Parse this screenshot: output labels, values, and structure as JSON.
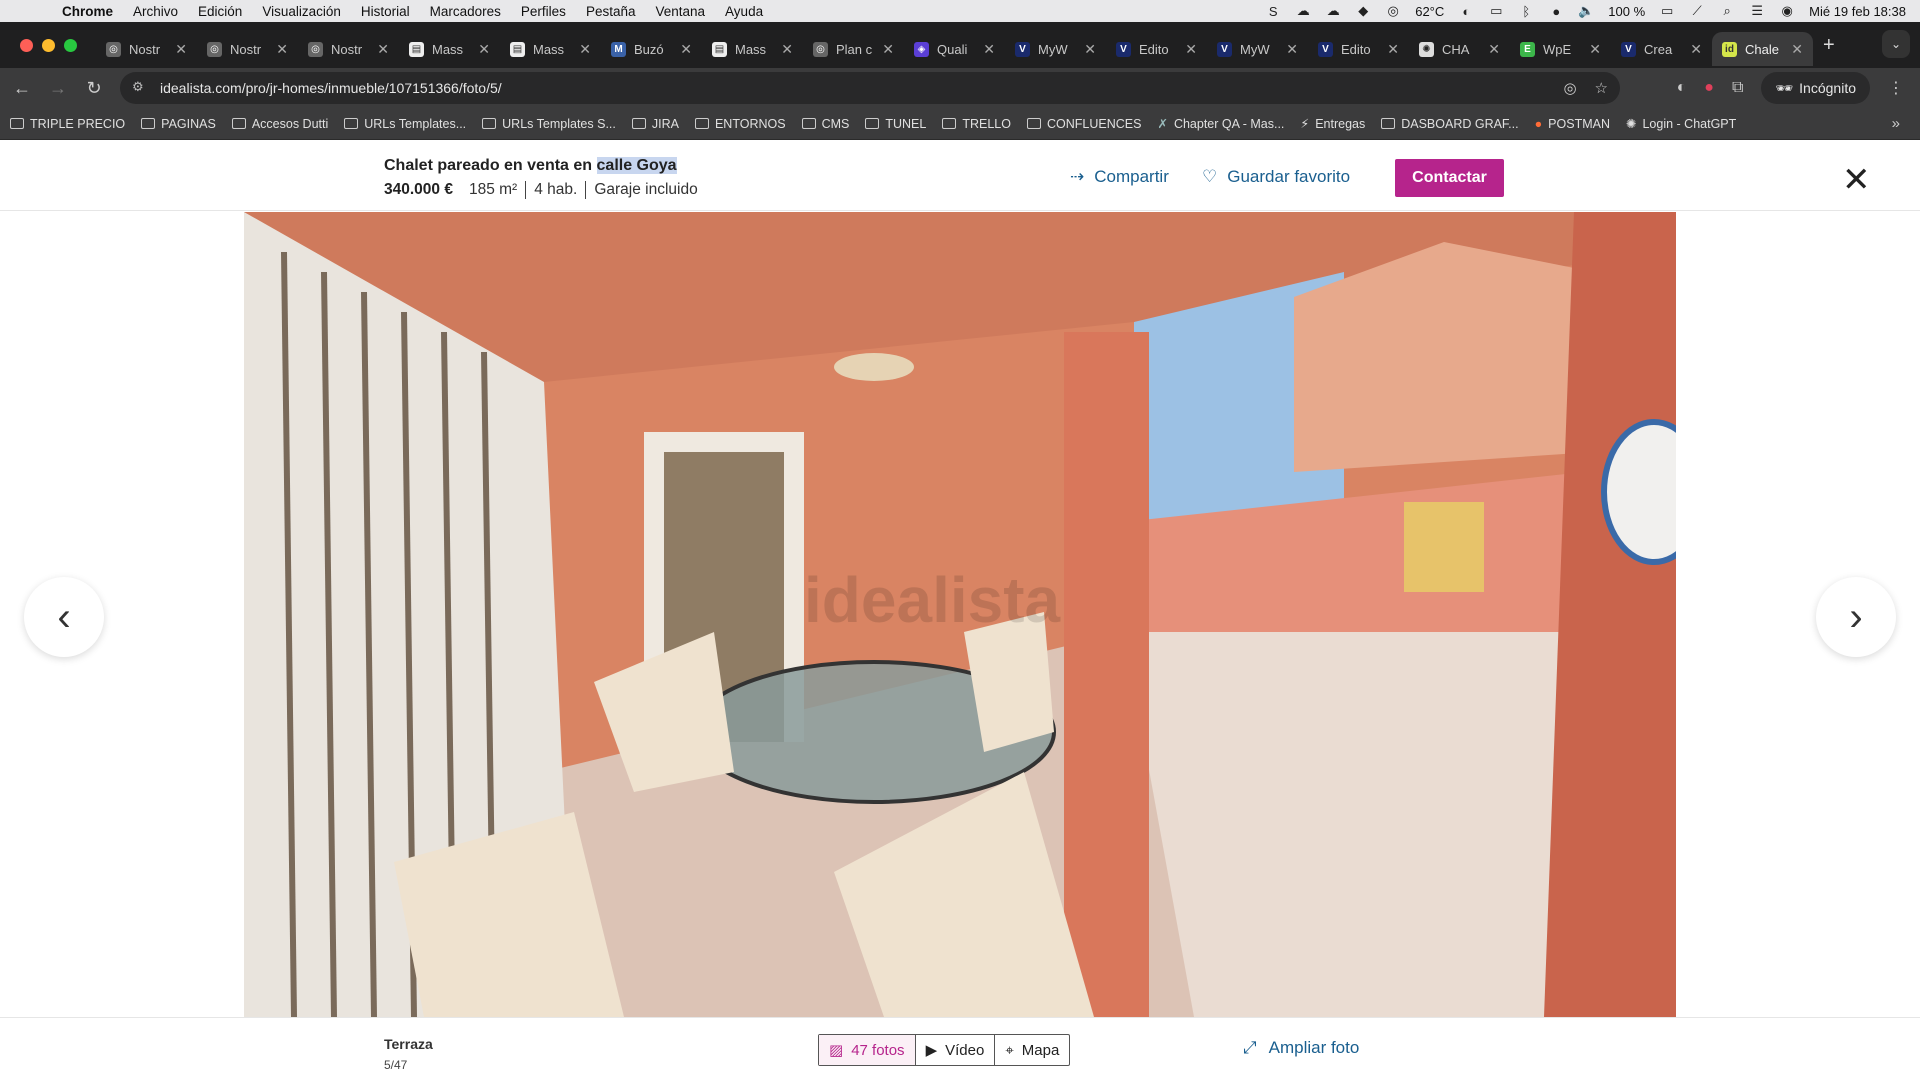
{
  "menubar": {
    "app": "Chrome",
    "items": [
      "Archivo",
      "Edición",
      "Visualización",
      "Historial",
      "Marcadores",
      "Perfiles",
      "Pestaña",
      "Ventana",
      "Ayuda"
    ],
    "temperature": "62°C",
    "battery": "100 %",
    "datetime": "Mié 19 feb 18:38"
  },
  "tabs": [
    {
      "title": "Nostr",
      "icon": "globe-icon"
    },
    {
      "title": "Nostr",
      "icon": "globe-icon"
    },
    {
      "title": "Nostr",
      "icon": "globe-icon"
    },
    {
      "title": "Mass",
      "icon": "doc-icon"
    },
    {
      "title": "Mass",
      "icon": "doc-icon"
    },
    {
      "title": "Buzó",
      "icon": "mail-icon"
    },
    {
      "title": "Mass",
      "icon": "doc-icon"
    },
    {
      "title": "Plan c",
      "icon": "globe-icon"
    },
    {
      "title": "Quali",
      "icon": "shield-icon"
    },
    {
      "title": "MyW",
      "icon": "v-icon"
    },
    {
      "title": "Edito",
      "icon": "v-icon"
    },
    {
      "title": "MyW",
      "icon": "v-icon"
    },
    {
      "title": "Edito",
      "icon": "v-icon"
    },
    {
      "title": "CHA",
      "icon": "openai-icon"
    },
    {
      "title": "WpE",
      "icon": "wpe-icon"
    },
    {
      "title": "Crea",
      "icon": "v-icon"
    },
    {
      "title": "Chale",
      "icon": "idealista-icon",
      "active": true
    }
  ],
  "address": {
    "url": "idealista.com/pro/jr-homes/inmueble/107151366/foto/5/",
    "incognito": "Incógnito"
  },
  "bookmarks": [
    {
      "label": "TRIPLE PRECIO",
      "type": "folder"
    },
    {
      "label": "PAGINAS",
      "type": "folder"
    },
    {
      "label": "Accesos Dutti",
      "type": "folder"
    },
    {
      "label": "URLs Templates...",
      "type": "folder"
    },
    {
      "label": "URLs Templates S...",
      "type": "folder"
    },
    {
      "label": "JIRA",
      "type": "folder"
    },
    {
      "label": "ENTORNOS",
      "type": "folder"
    },
    {
      "label": "CMS",
      "type": "folder"
    },
    {
      "label": "TUNEL",
      "type": "folder"
    },
    {
      "label": "TRELLO",
      "type": "folder"
    },
    {
      "label": "CONFLUENCES",
      "type": "folder"
    },
    {
      "label": "Chapter QA - Mas...",
      "type": "link"
    },
    {
      "label": "Entregas",
      "type": "link"
    },
    {
      "label": "DASBOARD GRAF...",
      "type": "folder"
    },
    {
      "label": "POSTMAN",
      "type": "link"
    },
    {
      "label": "Login - ChatGPT",
      "type": "link"
    }
  ],
  "listing": {
    "title_prefix": "Chalet pareado en venta en ",
    "title_street": "calle Goya",
    "price": "340.000 €",
    "area": "185 m²",
    "rooms": "4 hab.",
    "garage": "Garaje incluido",
    "share": "Compartir",
    "favorite": "Guardar favorito",
    "contact": "Contactar"
  },
  "photo": {
    "watermark": "idealista",
    "caption": "Terraza",
    "counter": "5/47"
  },
  "footer": {
    "photos": "47 fotos",
    "video": "Vídeo",
    "map": "Mapa",
    "enlarge": "Ampliar foto"
  },
  "colors": {
    "accent": "#b6248c",
    "link": "#1a5f8f"
  }
}
